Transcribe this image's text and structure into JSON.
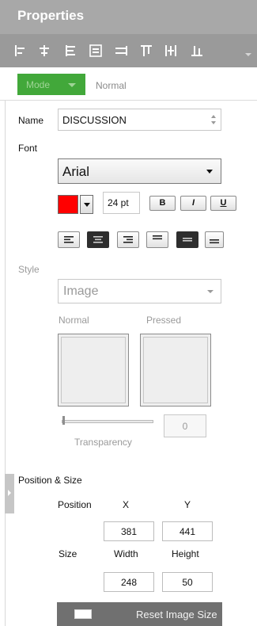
{
  "panel": {
    "title": "Properties"
  },
  "toolbar": {
    "icons": [
      "align-left-edges-icon",
      "align-horizontal-centers-icon",
      "align-right-edges-icon",
      "align-middle-icon",
      "distribute-horizontally-icon",
      "align-top-edges-icon",
      "distribute-vertically-icon",
      "align-bottom-edges-icon"
    ],
    "overflow_icon": "chevron-down-icon"
  },
  "mode": {
    "button_label": "Mode",
    "value": "Normal"
  },
  "name": {
    "label": "Name",
    "value": "DISCUSSION"
  },
  "font": {
    "label": "Font",
    "family": "Arial",
    "color": "#ff0000",
    "size": "24 pt",
    "bold_label": "B",
    "italic_label": "I",
    "underline_label": "U",
    "alignments": [
      "align-left",
      "align-center",
      "align-right",
      "valign-top",
      "valign-middle",
      "valign-bottom"
    ],
    "active_alignments": [
      "align-center",
      "valign-middle"
    ]
  },
  "style": {
    "label": "Style",
    "value": "Image",
    "normal_label": "Normal",
    "pressed_label": "Pressed",
    "transparency_label": "Transparency",
    "transparency_value": "0"
  },
  "position_size": {
    "section_label": "Position & Size",
    "position_label": "Position",
    "x_label": "X",
    "y_label": "Y",
    "x_value": "381",
    "y_value": "441",
    "size_label": "Size",
    "width_label": "Width",
    "height_label": "Height",
    "width_value": "248",
    "height_value": "50",
    "reset_label": "Reset Image Size"
  },
  "colors": {
    "accent_green": "#42a83a",
    "header_gray": "#a8a8a8",
    "toolbar_gray": "#9a9a9a",
    "button_dark": "#707070"
  }
}
